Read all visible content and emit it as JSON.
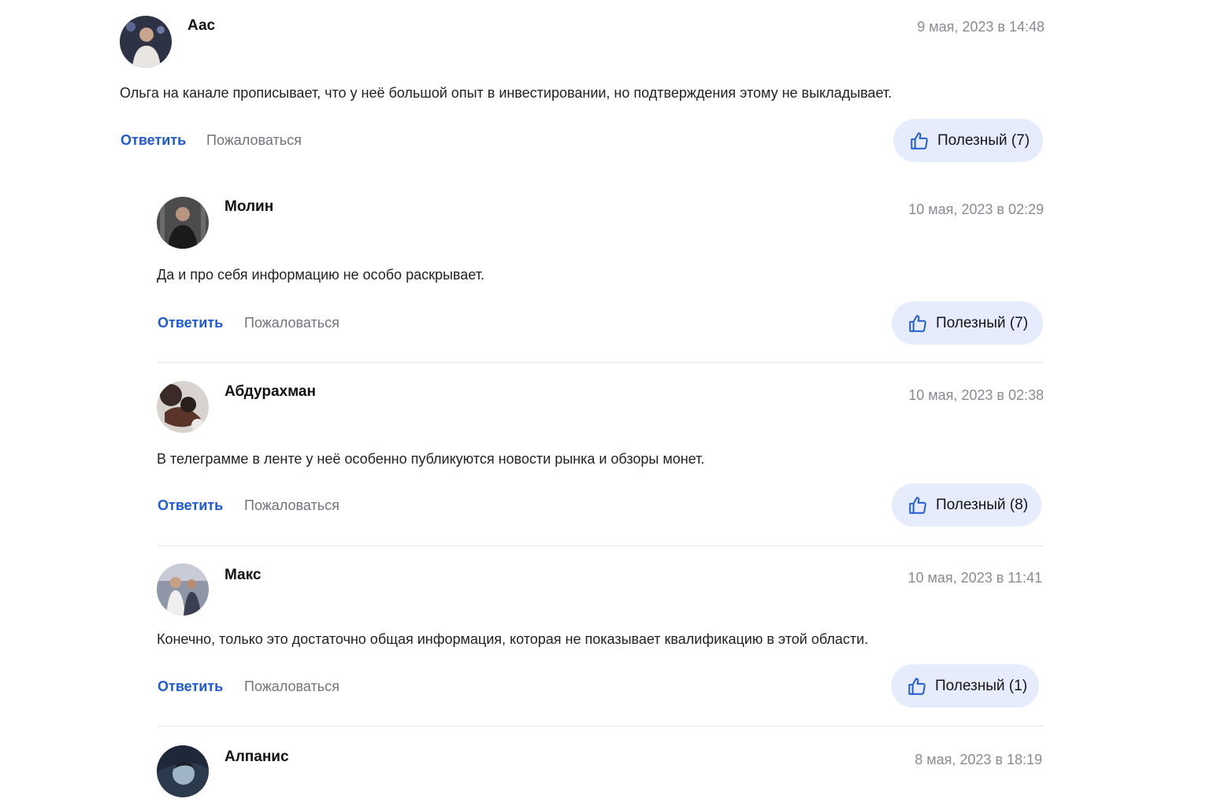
{
  "comments": [
    {
      "author": "Аас",
      "date": "9 мая, 2023 в 14:48",
      "text": "Ольга на канале прописывает, что у неё большой опыт в инвестировании, но подтверждения этому не выкладывает.",
      "reply_label": "Ответить",
      "report_label": "Пожаловаться",
      "useful_label": "Полезный (7)",
      "useful_count": 7
    },
    {
      "author": "Молин",
      "date": "10 мая, 2023 в 02:29",
      "text": "Да и про себя информацию не особо раскрывает.",
      "reply_label": "Ответить",
      "report_label": "Пожаловаться",
      "useful_label": "Полезный (7)",
      "useful_count": 7
    },
    {
      "author": "Абдурахман",
      "date": "10 мая, 2023 в 02:38",
      "text": "В телеграмме в ленте у неё особенно публикуются новости рынка и обзоры монет.",
      "reply_label": "Ответить",
      "report_label": "Пожаловаться",
      "useful_label": "Полезный (8)",
      "useful_count": 8
    },
    {
      "author": "Макс",
      "date": "10 мая, 2023 в 11:41",
      "text": "Конечно, только это достаточно общая информация, которая не показывает квалификацию в этой области.",
      "reply_label": "Ответить",
      "report_label": "Пожаловаться",
      "useful_label": "Полезный (1)",
      "useful_count": 1
    },
    {
      "author": "Алпанис",
      "date": "8 мая, 2023 в 18:19"
    }
  ],
  "colors": {
    "accent": "#1f5ad6",
    "useful_bg": "#e6ecfb",
    "muted": "#8a8a92"
  },
  "icons": {
    "useful": "thumbs-up-icon"
  }
}
